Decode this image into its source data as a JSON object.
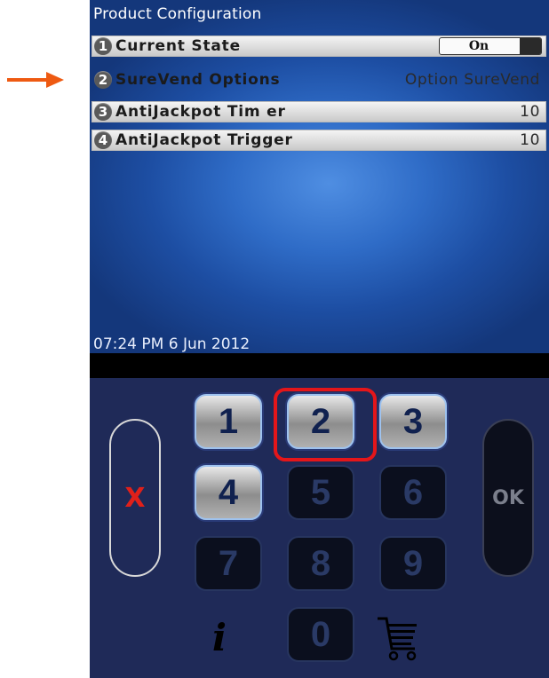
{
  "screen": {
    "title": "Product Configuration",
    "rows": [
      {
        "num": "1",
        "label": "Current State",
        "value": "On"
      },
      {
        "num": "2",
        "label": "SureVend Options",
        "value": "Option SureVend"
      },
      {
        "num": "3",
        "label": "AntiJackpot Tim er",
        "value": "10"
      },
      {
        "num": "4",
        "label": "AntiJackpot Trigger",
        "value": "10"
      }
    ],
    "timestamp": "07:24 PM 6 Jun 2012"
  },
  "keypad": {
    "keys": [
      "1",
      "2",
      "3",
      "4",
      "5",
      "6",
      "7",
      "8",
      "9",
      "0"
    ],
    "active_keys": [
      "1",
      "2",
      "3",
      "4"
    ],
    "cancel_label": "X",
    "ok_label": "OK",
    "info_label": "i"
  },
  "annotations": {
    "arrow_points_to": "SureVend Options",
    "highlighted_key": "2",
    "highlight_color": "#e4161a",
    "arrow_color": "#ee5a12"
  },
  "colors": {
    "screen_bg": "#2f6cc7",
    "keypad_bg": "#1f2a58"
  }
}
